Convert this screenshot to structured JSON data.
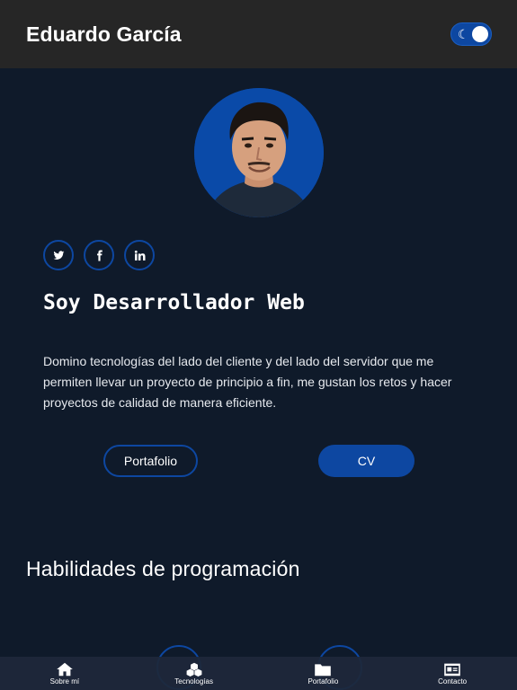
{
  "header": {
    "title": "Eduardo García",
    "theme_toggle_state": "dark"
  },
  "profile": {
    "headline": "Soy Desarrollador Web",
    "bio": "Domino tecnologías del lado del cliente y del lado del servidor que me permiten llevar un proyecto de principio a fin, me gustan los retos y hacer proyectos de calidad de manera eficiente.",
    "socials": [
      {
        "icon": "twitter-icon"
      },
      {
        "icon": "facebook-icon"
      },
      {
        "icon": "linkedin-icon"
      }
    ],
    "buttons": {
      "portfolio": "Portafolio",
      "cv": "CV"
    }
  },
  "skills": {
    "title": "Habilidades de programación"
  },
  "bottom_nav": {
    "items": [
      {
        "label": "Sobre mí",
        "icon": "home-icon"
      },
      {
        "label": "Tecnologías",
        "icon": "cubes-icon"
      },
      {
        "label": "Portafolio",
        "icon": "folder-icon"
      },
      {
        "label": "Contacto",
        "icon": "contact-card-icon"
      }
    ]
  },
  "colors": {
    "background": "#0f1a2a",
    "header": "#262626",
    "accent": "#0d47a1"
  }
}
